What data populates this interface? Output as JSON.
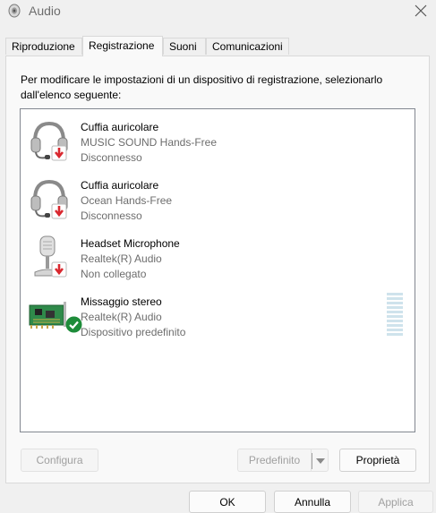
{
  "window": {
    "title": "Audio",
    "icon": "speaker-icon",
    "close_icon": "close-icon"
  },
  "tabs": [
    {
      "label": "Riproduzione",
      "active": false
    },
    {
      "label": "Registrazione",
      "active": true
    },
    {
      "label": "Suoni",
      "active": false
    },
    {
      "label": "Comunicazioni",
      "active": false
    }
  ],
  "instructions": "Per modificare le impostazioni di un dispositivo di registrazione, selezionarlo dall'elenco seguente:",
  "devices": [
    {
      "name": "Cuffia auricolare",
      "detail": "MUSIC SOUND Hands-Free",
      "state": "Disconnesso",
      "icon": "headset-icon",
      "badge": "disconnected-badge-icon"
    },
    {
      "name": "Cuffia auricolare",
      "detail": "Ocean Hands-Free",
      "state": "Disconnesso",
      "icon": "headset-icon",
      "badge": "disconnected-badge-icon"
    },
    {
      "name": "Headset Microphone",
      "detail": "Realtek(R) Audio",
      "state": "Non collegato",
      "icon": "microphone-icon",
      "badge": "disconnected-badge-icon"
    },
    {
      "name": "Missaggio stereo",
      "detail": "Realtek(R) Audio",
      "state": "Dispositivo predefinito",
      "icon": "sound-card-icon",
      "badge": "default-check-icon"
    }
  ],
  "panel_buttons": {
    "configure": "Configura",
    "default": "Predefinito",
    "properties": "Proprietà"
  },
  "dialog_buttons": {
    "ok": "OK",
    "cancel": "Annulla",
    "apply": "Applica"
  },
  "colors": {
    "disconnected_badge": "#d9282f",
    "default_badge": "#1e8c3a",
    "level_meter": "#cfe3ec"
  }
}
